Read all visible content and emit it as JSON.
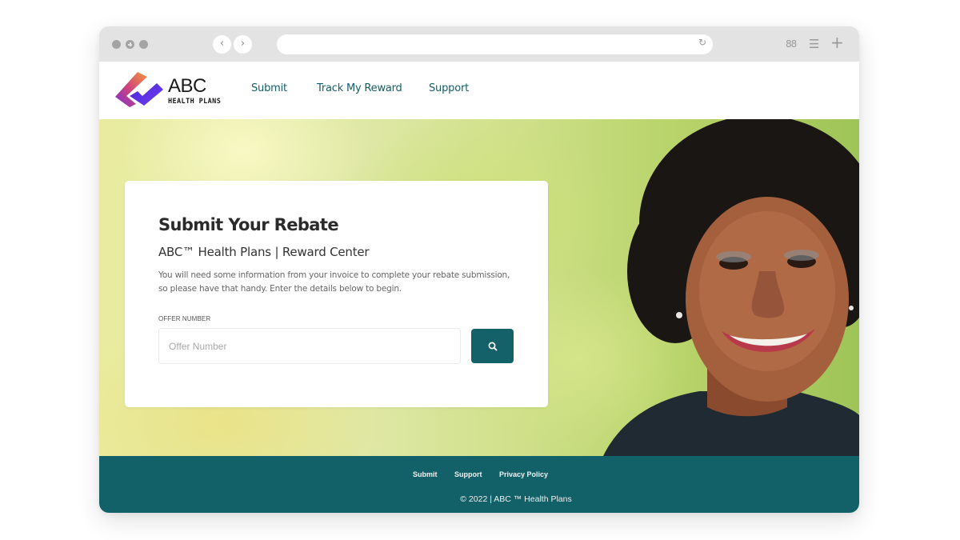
{
  "browser": {
    "back_icon": "chevron-left-icon",
    "forward_icon": "chevron-right-icon",
    "reload_icon": "reload-icon",
    "url": "",
    "tabs_icon": "grid-icon",
    "menu_icon": "hamburger-menu-icon",
    "new_tab_icon": "plus-icon",
    "back_glyph": "‹",
    "forward_glyph": "›",
    "reload_glyph": "↻",
    "tabs_glyph": "88",
    "menu_glyph": "☰",
    "new_tab_glyph": "+"
  },
  "header": {
    "logo": {
      "title": "ABC",
      "subtitle": "HEALTH PLANS"
    },
    "nav": [
      {
        "label": "Submit"
      },
      {
        "label": "Track My Reward"
      },
      {
        "label": "Support"
      }
    ]
  },
  "hero": {
    "card": {
      "title": "Submit Your Rebate",
      "subtitle": "ABC™ Health Plans | Reward Center",
      "description": "You will need some information from your invoice to complete your rebate submission, so please have that handy. Enter the details below to begin.",
      "field_label": "OFFER NUMBER",
      "input_placeholder": "Offer Number",
      "input_value": "",
      "search_icon": "search-icon"
    }
  },
  "footer": {
    "links": [
      {
        "label": "Submit"
      },
      {
        "label": "Support"
      },
      {
        "label": "Privacy Policy"
      }
    ],
    "copyright": "© 2022 | ABC ™ Health Plans"
  },
  "colors": {
    "brand_teal": "#126068",
    "nav_link": "#125e66",
    "logo_orange": "#f07a3a",
    "logo_purple": "#5a3be0"
  }
}
